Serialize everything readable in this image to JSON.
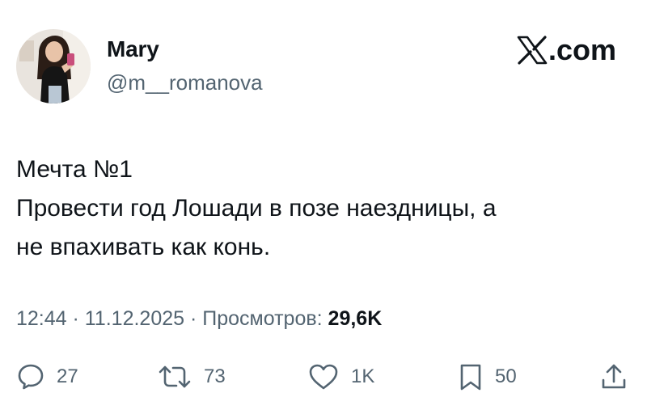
{
  "author": {
    "display_name": "Mary",
    "handle": "@m__romanova"
  },
  "brand": {
    "icon": "x-logo-icon",
    "domain": ".com"
  },
  "tweet": {
    "lines": [
      "Мечта №1",
      "Провести год Лошади в позе наездницы, а",
      "не впахивать как конь."
    ]
  },
  "meta": {
    "time": "12:44",
    "separator": " · ",
    "date": "11.12.2025",
    "views_label": "Просмотров:",
    "views_count": "29,6K"
  },
  "actions": {
    "reply": {
      "icon": "reply-icon",
      "count": "27"
    },
    "repost": {
      "icon": "repost-icon",
      "count": "73"
    },
    "like": {
      "icon": "heart-icon",
      "count": "1K"
    },
    "bookmark": {
      "icon": "bookmark-icon",
      "count": "50"
    },
    "share": {
      "icon": "share-icon"
    }
  },
  "colors": {
    "text_primary": "#0f1419",
    "text_secondary": "#536471",
    "background": "#ffffff"
  }
}
